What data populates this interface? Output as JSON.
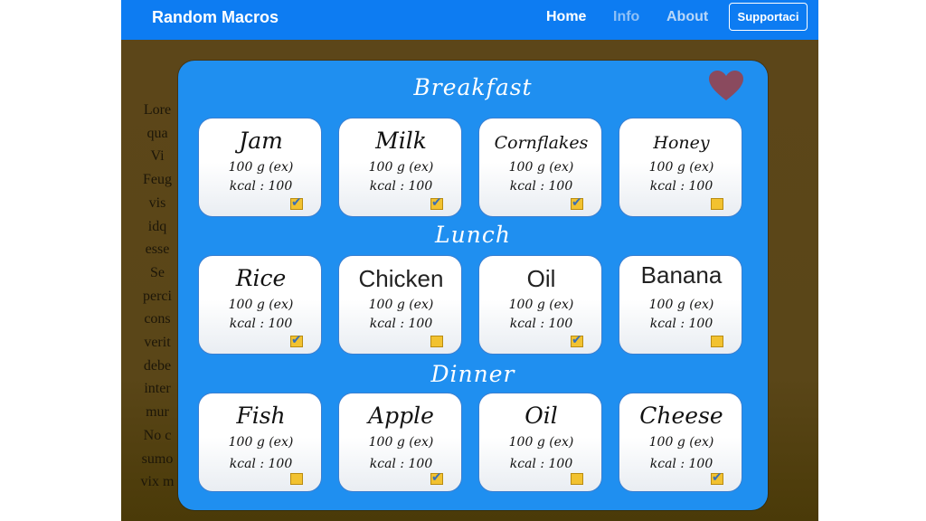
{
  "navbar": {
    "brand": "Random Macros",
    "links": [
      "Home",
      "Info",
      "About"
    ],
    "support_button": "Supportaci"
  },
  "background_text": {
    "lines": [
      "Lore",
      "qua",
      "Vi",
      "Feug",
      "vis",
      "idq",
      "esse",
      "Se",
      "perci",
      "cons",
      "verit",
      "debe",
      "inter",
      "mur",
      "No c",
      "sumo",
      "vix m"
    ]
  },
  "icons": {
    "favorite": "heart-icon",
    "checkbox": "checkbox-icon"
  },
  "colors": {
    "navbar": "#0d7cf2",
    "modal": "#1f8ff0",
    "heart": "#8a4a5e",
    "checkbox": "#f2c230"
  },
  "sections": [
    {
      "title": "Breakfast",
      "items": [
        {
          "name": "Jam",
          "qty": "100 g (ex)",
          "kcal": "kcal : 100",
          "checked": true
        },
        {
          "name": "Milk",
          "qty": "100 g (ex)",
          "kcal": "kcal : 100",
          "checked": true
        },
        {
          "name": "Cornflakes",
          "qty": "100 g (ex)",
          "kcal": "kcal : 100",
          "checked": true
        },
        {
          "name": "Honey",
          "qty": "100 g (ex)",
          "kcal": "kcal : 100",
          "checked": false
        }
      ]
    },
    {
      "title": "Lunch",
      "items": [
        {
          "name": "Rice",
          "qty": "100 g (ex)",
          "kcal": "kcal : 100",
          "checked": true
        },
        {
          "name": "Chicken",
          "qty": "100 g (ex)",
          "kcal": "kcal : 100",
          "checked": false
        },
        {
          "name": "Oil",
          "qty": "100 g (ex)",
          "kcal": "kcal : 100",
          "checked": true
        },
        {
          "name": "Banana",
          "qty": "100 g (ex)",
          "kcal": "kcal : 100",
          "checked": false
        }
      ]
    },
    {
      "title": "Dinner",
      "items": [
        {
          "name": "Fish",
          "qty": "100 g (ex)",
          "kcal": "kcal : 100",
          "checked": false
        },
        {
          "name": "Apple",
          "qty": "100 g (ex)",
          "kcal": "kcal : 100",
          "checked": true
        },
        {
          "name": "Oil",
          "qty": "100 g (ex)",
          "kcal": "kcal : 100",
          "checked": false
        },
        {
          "name": "Cheese",
          "qty": "100 g (ex)",
          "kcal": "kcal : 100",
          "checked": true
        }
      ]
    }
  ]
}
